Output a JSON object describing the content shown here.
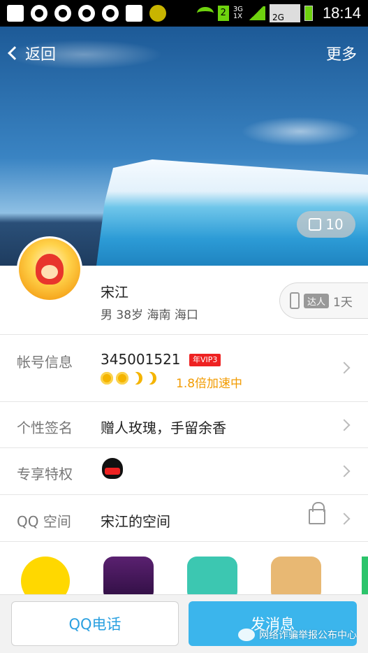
{
  "status_bar": {
    "time": "18:14",
    "sim_slot": "2",
    "network_3g": "3G",
    "network_1x": "1X",
    "network_2g": "2G"
  },
  "nav": {
    "back_label": "返回",
    "more_label": "更多"
  },
  "hero": {
    "like_count": "10"
  },
  "profile": {
    "name": "宋江",
    "details": "男 38岁 海南 海口",
    "daren_tag": "达人",
    "daren_days": "1天"
  },
  "account": {
    "label": "帐号信息",
    "qq_number": "345001521",
    "vip_badge": "年VIP3",
    "speed_text": "1.8倍加速中"
  },
  "signature": {
    "label": "个性签名",
    "value": "赠人玫瑰，手留余香"
  },
  "privilege": {
    "label": "专享特权"
  },
  "qzone": {
    "label": "QQ 空间",
    "value": "宋江的空间"
  },
  "bottom": {
    "call_label": "QQ电话",
    "message_label": "发消息",
    "watermark": "网络诈骗举报公布中心"
  },
  "colors": {
    "accent_blue": "#3bb5ec",
    "speed_orange": "#f29b00",
    "vip_red": "#e22222"
  }
}
